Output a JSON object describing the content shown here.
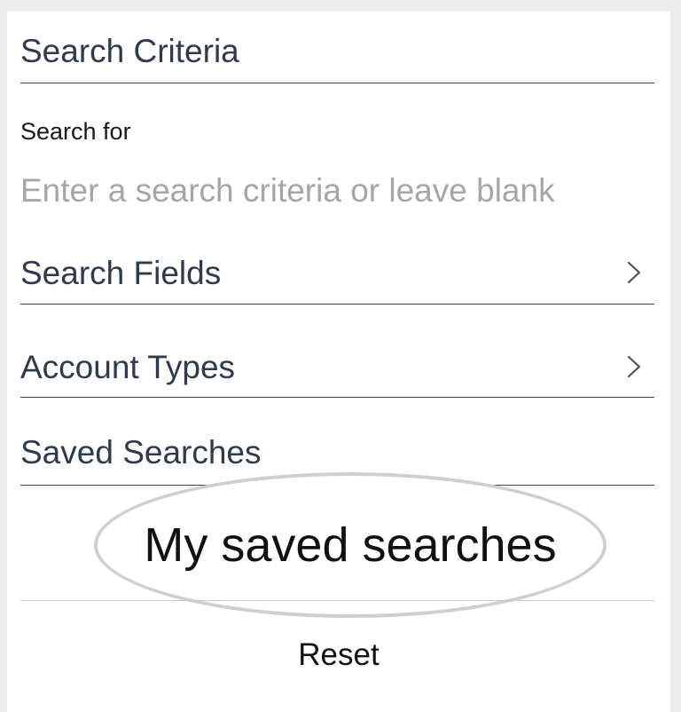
{
  "criteria": {
    "title": "Search Criteria",
    "search_for_label": "Search for",
    "search_placeholder": "Enter a search criteria or leave blank",
    "search_value": ""
  },
  "rows": {
    "search_fields": "Search Fields",
    "account_types": "Account Types",
    "saved_searches": "Saved Searches",
    "chevron_icon": "chevron-right-icon"
  },
  "saved": {
    "entry_label": "My saved searches"
  },
  "footer": {
    "reset_label": "Reset"
  },
  "colors": {
    "text_primary": "#2f3b4a",
    "placeholder": "#a6a6a6",
    "highlight_oval": "#cfcfcf"
  }
}
